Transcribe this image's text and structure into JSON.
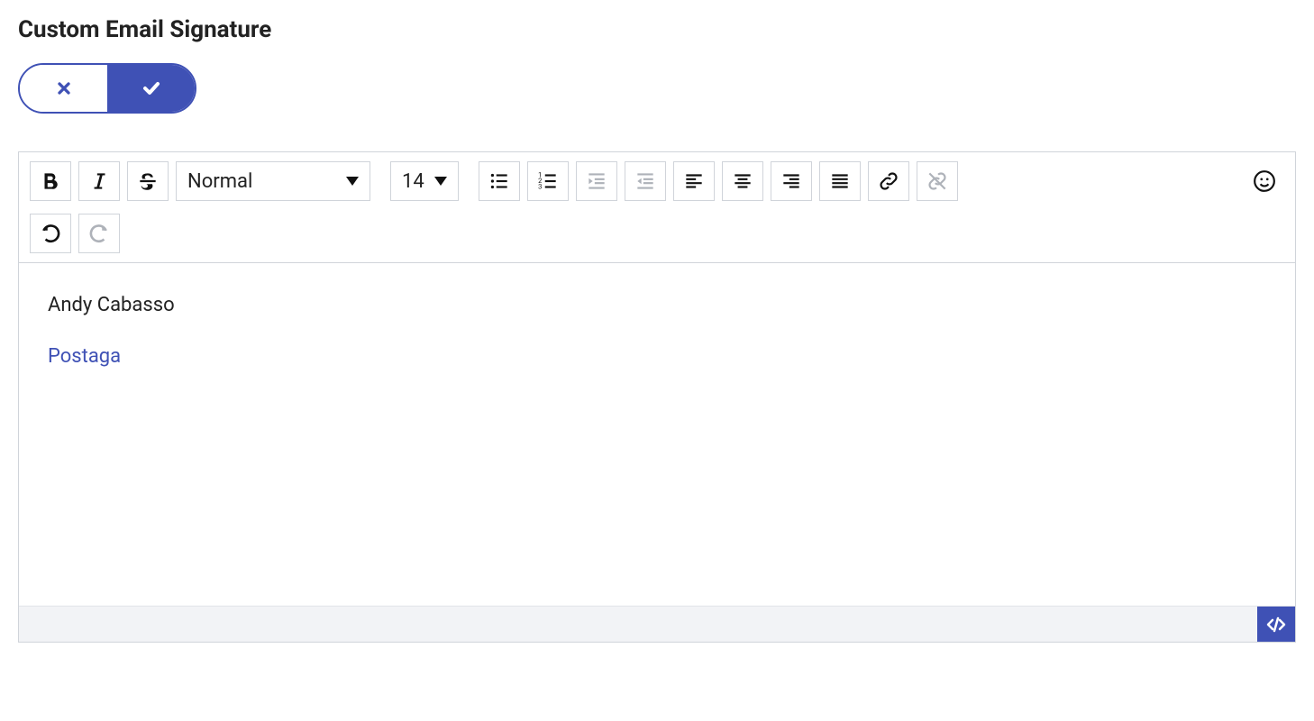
{
  "title": "Custom Email Signature",
  "toolbar": {
    "style_select": "Normal",
    "size_select": "14"
  },
  "signature": {
    "line1": "Andy Cabasso",
    "link_text": "Postaga"
  },
  "colors": {
    "primary": "#3f51b5"
  }
}
